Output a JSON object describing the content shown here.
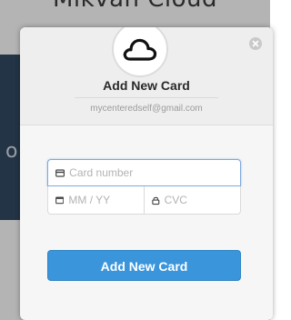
{
  "background": {
    "heading": "Mikvah Cloud"
  },
  "modal": {
    "logo_icon": "cloud-icon",
    "close_icon": "close-icon",
    "title": "Add New Card",
    "email": "mycenteredself@gmail.com"
  },
  "form": {
    "card_number": {
      "placeholder": "Card number",
      "icon": "credit-card-icon",
      "value": ""
    },
    "expiry": {
      "placeholder": "MM / YY",
      "icon": "calendar-icon",
      "value": ""
    },
    "cvc": {
      "placeholder": "CVC",
      "icon": "lock-icon",
      "value": ""
    },
    "submit_label": "Add New Card"
  },
  "colors": {
    "accent": "#3a95db",
    "focus_border": "#7fa8dc"
  }
}
